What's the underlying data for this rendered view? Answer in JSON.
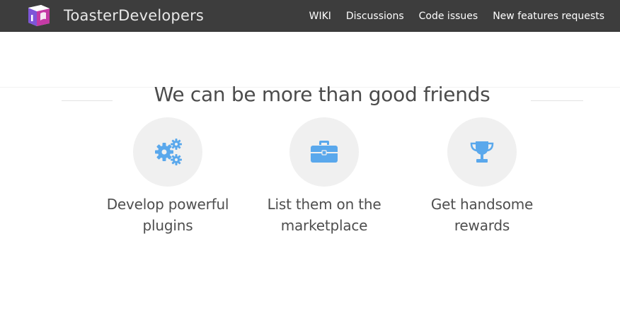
{
  "header": {
    "brand": "ToasterDevelopers",
    "nav": [
      "WIKI",
      "Discussions",
      "Code issues",
      "New features requests"
    ]
  },
  "main": {
    "headline": "We can be more than good friends",
    "features": [
      {
        "icon": "gears-icon",
        "line1": "Develop powerful",
        "line2": "plugins"
      },
      {
        "icon": "briefcase-icon",
        "line1": "List them on the",
        "line2": "marketplace"
      },
      {
        "icon": "trophy-icon",
        "line1": "Get handsome",
        "line2": "rewards"
      }
    ]
  },
  "colors": {
    "navbar": "#3d3d3d",
    "icon_accent": "#5aa8ec",
    "circle_bg": "#f0f0f0"
  }
}
